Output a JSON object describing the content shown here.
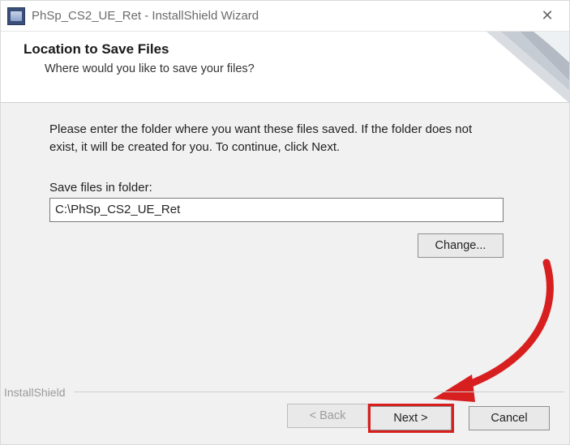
{
  "titlebar": {
    "title": "PhSp_CS2_UE_Ret - InstallShield Wizard"
  },
  "header": {
    "heading": "Location to Save Files",
    "subheading": "Where would you like to save your files?"
  },
  "body": {
    "instruction": "Please enter the folder where you want these files saved.  If the folder does not exist, it will be created for you.   To continue, click Next.",
    "field_label": "Save files in folder:",
    "path_value": "C:\\PhSp_CS2_UE_Ret",
    "change_label": "Change..."
  },
  "footer": {
    "brand": "InstallShield",
    "back_label": "< Back",
    "next_label": "Next >",
    "cancel_label": "Cancel"
  }
}
